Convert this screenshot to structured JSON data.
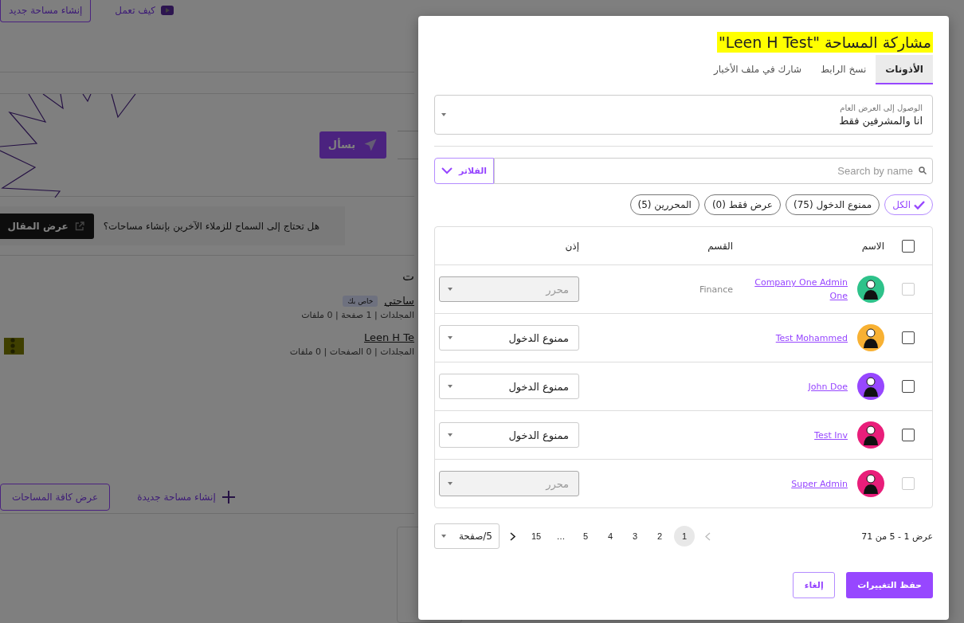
{
  "background": {
    "top_buttons": [
      {
        "label": "كيف تعمل",
        "kind": "video"
      },
      {
        "label": "إنشاء مساحة جديد",
        "kind": "outline"
      }
    ],
    "ask_button": "بسأل",
    "banner": {
      "text": "هل تحتاج إلى السماح للزملاء الآخرين بإنشاء مساحات؟",
      "button": "عرض المقال"
    },
    "section_title": "ت",
    "spaces": [
      {
        "name": "ساحتي",
        "badge": "خاص بك",
        "meta": "المجلدات | 1 صفحة | 0 ملفات",
        "menu": false
      },
      {
        "name": "Leen H Te",
        "meta": "المجلدات | 0 الصفحات | 0 ملفات",
        "menu": true
      }
    ],
    "create_link": "إنشاء مساحة جديدة",
    "view_all": "عرض كافة المساحات"
  },
  "dialog": {
    "title": "مشاركة المساحة \"Leen H Test\"",
    "tabs": [
      {
        "label": "الأذونات",
        "selected": true
      },
      {
        "label": "نسخ الرابط",
        "selected": false
      },
      {
        "label": "شارك في ملف الأخبار",
        "selected": false
      }
    ],
    "access": {
      "label": "الوصول إلى العرض العام",
      "value": "انا والمشرفين فقط"
    },
    "search": {
      "placeholder": "Search by name"
    },
    "filters_button": "الفلاتر",
    "chips": [
      {
        "label": "الكل",
        "selected": true
      },
      {
        "label": "ممنوع الدخول (75)",
        "selected": false
      },
      {
        "label": "عرض فقط (0)",
        "selected": false
      },
      {
        "label": "المحررين (5)",
        "selected": false
      }
    ],
    "table": {
      "select_all": {
        "checked": false
      },
      "columns": [
        "الاسم",
        "القسم",
        "إذن"
      ],
      "rows": [
        {
          "name": "Company One Admin One",
          "department": "Finance",
          "permission": "محرر",
          "disabled": true,
          "checked": false,
          "color": "#2ec28a"
        },
        {
          "name": "Test Mohammed",
          "permission": "ممنوع الدخول",
          "disabled": false,
          "checked": false,
          "color": "#f8b133"
        },
        {
          "name": "John Doe",
          "permission": "ممنوع الدخول",
          "disabled": false,
          "checked": false,
          "color": "#9747ff"
        },
        {
          "name": "Test Inv",
          "permission": "ممنوع الدخول",
          "disabled": false,
          "checked": false,
          "color": "#e91e7a"
        },
        {
          "name": "Super Admin",
          "permission": "محرر",
          "disabled": true,
          "checked": false,
          "color": "#e91e7a"
        }
      ]
    },
    "pagination": {
      "summary": "عرض 1 - 5 من 71",
      "pages": [
        {
          "label": "1",
          "selected": true
        },
        {
          "label": "2",
          "selected": false
        },
        {
          "label": "3",
          "selected": false
        },
        {
          "label": "4",
          "selected": false
        },
        {
          "label": "5",
          "selected": false
        },
        {
          "label": "…",
          "selected": false
        },
        {
          "label": "15",
          "selected": false
        }
      ],
      "page_size": "5/صفحة"
    },
    "buttons": [
      {
        "label": "حفظ التغييرات",
        "kind": "primary"
      },
      {
        "label": "إلغاء",
        "kind": "secondary"
      }
    ]
  }
}
